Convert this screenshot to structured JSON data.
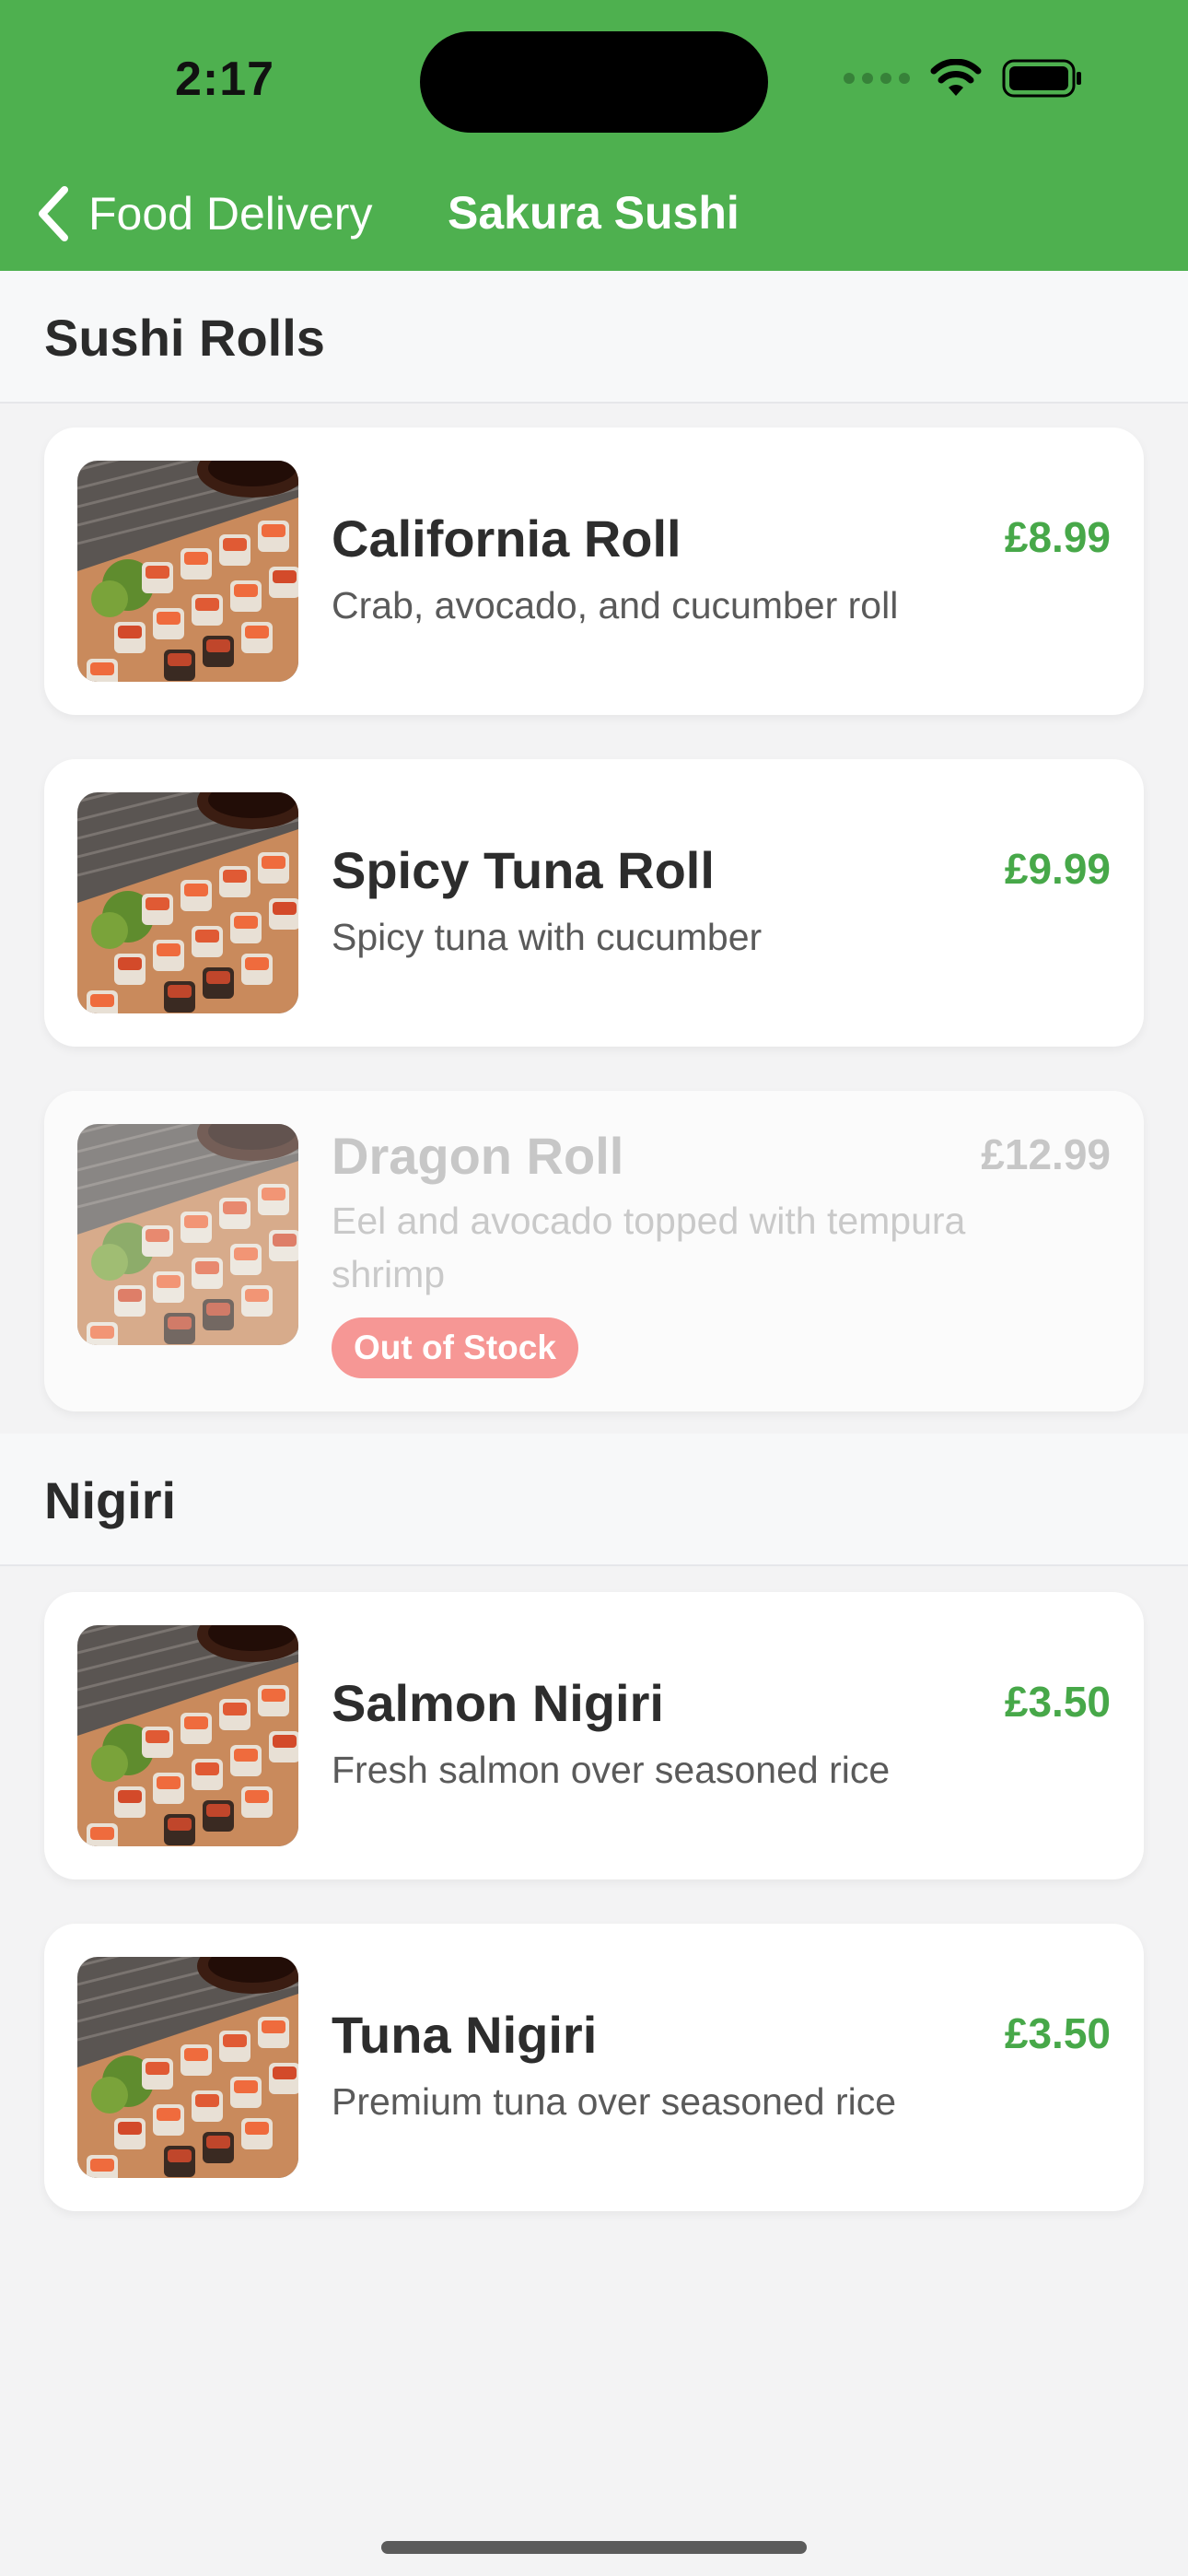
{
  "status_bar": {
    "time": "2:17"
  },
  "nav": {
    "back_label": "Food Delivery",
    "title": "Sakura Sushi"
  },
  "colors": {
    "brand": "#4eb04f",
    "price": "#47a849",
    "badge": "#f69795"
  },
  "sections": [
    {
      "title": "Sushi Rolls",
      "items": [
        {
          "name": "California Roll",
          "description": "Crab, avocado, and cucumber roll",
          "price": "£8.99"
        },
        {
          "name": "Spicy Tuna Roll",
          "description": "Spicy tuna with cucumber",
          "price": "£9.99"
        },
        {
          "name": "Dragon Roll",
          "description": "Eel and avocado topped with tempura shrimp",
          "price": "£12.99",
          "badge": "Out of Stock"
        }
      ]
    },
    {
      "title": "Nigiri",
      "items": [
        {
          "name": "Salmon Nigiri",
          "description": "Fresh salmon over seasoned rice",
          "price": "£3.50"
        },
        {
          "name": "Tuna Nigiri",
          "description": "Premium tuna over seasoned rice",
          "price": "£3.50"
        }
      ]
    }
  ]
}
